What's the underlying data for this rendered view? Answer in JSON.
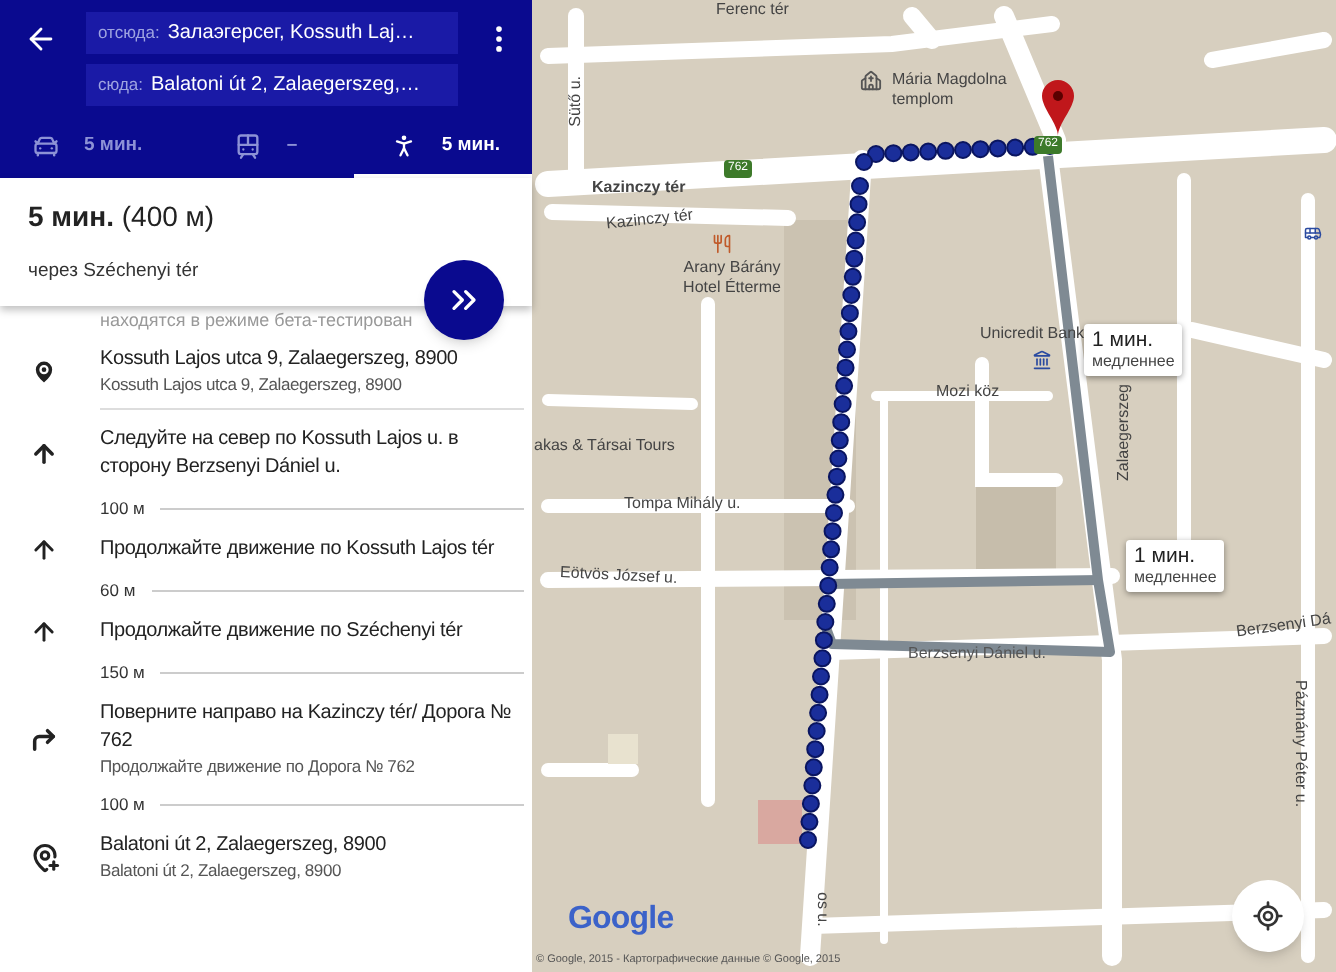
{
  "header": {
    "from": {
      "label": "отсюда:",
      "value": "Залаэгерсег, Kossuth Laj…"
    },
    "to": {
      "label": "сюда:",
      "value": "Balatoni út 2, Zalaegerszeg,…"
    },
    "modes": [
      {
        "kind": "car",
        "time": "5 мин.",
        "selected": false
      },
      {
        "kind": "transit",
        "time": "–",
        "selected": false
      },
      {
        "kind": "walk",
        "time": "5 мин.",
        "selected": true
      }
    ]
  },
  "summary": {
    "time": "5 мин.",
    "distance": "(400 м)",
    "via": "через Széchenyi tér"
  },
  "notice": "находятся в режиме бета-тестирован",
  "steps": [
    {
      "kind": "start",
      "text": "Kossuth Lajos utca 9, Zalaegerszeg, 8900",
      "detail": "Kossuth Lajos utca 9, Zalaegerszeg, 8900"
    },
    {
      "kind": "north",
      "text": "Следуйте на север по Kossuth Lajos u. в сторону Berzsenyi Dániel u."
    },
    {
      "kind": "distance",
      "text": "100 м"
    },
    {
      "kind": "straight",
      "text": "Продолжайте движение по Kossuth Lajos tér"
    },
    {
      "kind": "distance",
      "text": "60 м"
    },
    {
      "kind": "straight",
      "text": "Продолжайте движение по Széchenyi tér"
    },
    {
      "kind": "distance",
      "text": "150 м"
    },
    {
      "kind": "turn_right",
      "text": "Поверните направо на Kazinczy tér/ Дорога № 762",
      "detail": "Продолжайте движение по Дорога № 762"
    },
    {
      "kind": "distance",
      "text": "100 м"
    },
    {
      "kind": "end",
      "text": "Balatoni út 2, Zalaegerszeg, 8900",
      "detail": "Balatoni út 2, Zalaegerszeg, 8900"
    }
  ],
  "map": {
    "labels": [
      "Ferenc tér",
      "Mária Magdolna templom",
      "Sütő u.",
      "Kazinczy tér",
      "Kazinczy tér",
      "Arany Bárány Hotel Étterme",
      "Unicredit Bank",
      "Mozi köz",
      "Zalaegerszeg",
      "akas & Társai Tours",
      "Tompa Mihály u.",
      "Eötvös József u.",
      "Berzsenyi Dániel u.",
      "Berzsenyi Dá",
      "Pázmány Péter u.",
      "os u."
    ],
    "shields": [
      "762",
      "762"
    ],
    "callouts": [
      {
        "time": "1 мин.",
        "note": "медленнее"
      },
      {
        "time": "1 мин.",
        "note": "медленнее"
      }
    ],
    "logo": "Google",
    "copyright": "© Google, 2015 - Картографические данные © Google, 2015"
  }
}
